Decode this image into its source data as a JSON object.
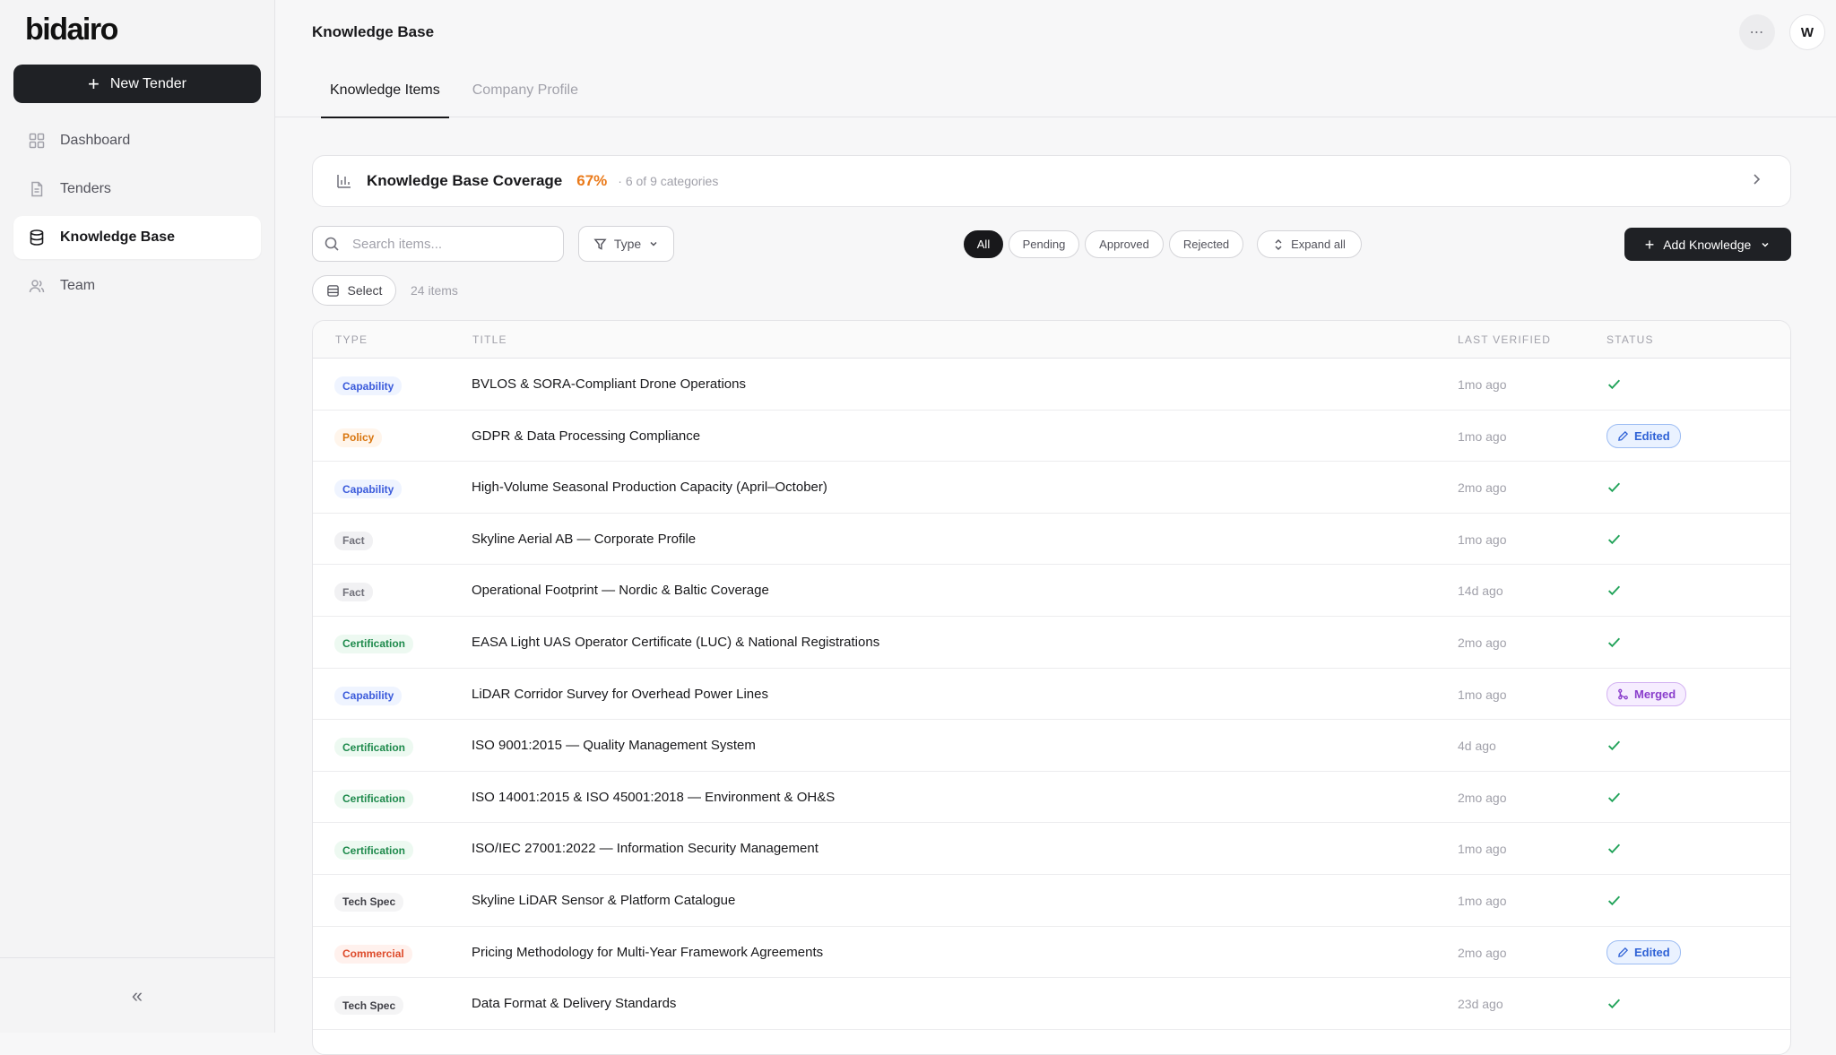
{
  "brand": {
    "logo_text": "bidairo"
  },
  "sidebar": {
    "new_tender_label": "New Tender",
    "items": [
      {
        "label": "Dashboard",
        "icon": "grid-icon",
        "active": false
      },
      {
        "label": "Tenders",
        "icon": "document-icon",
        "active": false
      },
      {
        "label": "Knowledge Base",
        "icon": "database-icon",
        "active": true
      },
      {
        "label": "Team",
        "icon": "users-icon",
        "active": false
      }
    ],
    "collapse_glyph": "«"
  },
  "header": {
    "title": "Knowledge Base",
    "avatar_initial": "W",
    "more_glyph": "⋯",
    "tabs": [
      {
        "label": "Knowledge Items",
        "active": true
      },
      {
        "label": "Company Profile",
        "active": false
      }
    ]
  },
  "coverage": {
    "title": "Knowledge Base Coverage",
    "percent": "67%",
    "subtitle": "· 6 of 9 categories",
    "accent_color": "#ea7a1a"
  },
  "toolbar": {
    "search_placeholder": "Search items...",
    "type_label": "Type",
    "filters": [
      {
        "label": "All",
        "active": true
      },
      {
        "label": "Pending",
        "active": false
      },
      {
        "label": "Approved",
        "active": false
      },
      {
        "label": "Rejected",
        "active": false
      }
    ],
    "expand_label": "Expand all",
    "add_label": "Add Knowledge"
  },
  "selection": {
    "select_label": "Select",
    "count_label": "24 items"
  },
  "table": {
    "columns": [
      "Type",
      "Title",
      "Last Verified",
      "Status"
    ],
    "rows": [
      {
        "type": "Capability",
        "type_key": "capability",
        "title": "BVLOS & SORA-Compliant Drone Operations",
        "verified": "1mo ago",
        "status": "approved"
      },
      {
        "type": "Policy",
        "type_key": "policy",
        "title": "GDPR & Data Processing Compliance",
        "verified": "1mo ago",
        "status": "edited",
        "status_label": "Edited"
      },
      {
        "type": "Capability",
        "type_key": "capability",
        "title": "High-Volume Seasonal Production Capacity (April–October)",
        "verified": "2mo ago",
        "status": "approved"
      },
      {
        "type": "Fact",
        "type_key": "fact",
        "title": "Skyline Aerial AB — Corporate Profile",
        "verified": "1mo ago",
        "status": "approved"
      },
      {
        "type": "Fact",
        "type_key": "fact",
        "title": "Operational Footprint — Nordic & Baltic Coverage",
        "verified": "14d ago",
        "status": "approved"
      },
      {
        "type": "Certification",
        "type_key": "certification",
        "title": "EASA Light UAS Operator Certificate (LUC) & National Registrations",
        "verified": "2mo ago",
        "status": "approved"
      },
      {
        "type": "Capability",
        "type_key": "capability",
        "title": "LiDAR Corridor Survey for Overhead Power Lines",
        "verified": "1mo ago",
        "status": "merged",
        "status_label": "Merged"
      },
      {
        "type": "Certification",
        "type_key": "certification",
        "title": "ISO 9001:2015 — Quality Management System",
        "verified": "4d ago",
        "status": "approved"
      },
      {
        "type": "Certification",
        "type_key": "certification",
        "title": "ISO 14001:2015 & ISO 45001:2018 — Environment & OH&S",
        "verified": "2mo ago",
        "status": "approved"
      },
      {
        "type": "Certification",
        "type_key": "certification",
        "title": "ISO/IEC 27001:2022 — Information Security Management",
        "verified": "1mo ago",
        "status": "approved"
      },
      {
        "type": "Tech Spec",
        "type_key": "techspec",
        "title": "Skyline LiDAR Sensor & Platform Catalogue",
        "verified": "1mo ago",
        "status": "approved"
      },
      {
        "type": "Commercial",
        "type_key": "commercial",
        "title": "Pricing Methodology for Multi-Year Framework Agreements",
        "verified": "2mo ago",
        "status": "edited",
        "status_label": "Edited"
      },
      {
        "type": "Tech Spec",
        "type_key": "techspec",
        "title": "Data Format & Delivery Standards",
        "verified": "23d ago",
        "status": "approved"
      }
    ]
  },
  "colors": {
    "primary_dark": "#1f2125",
    "check_green": "#22a35a",
    "edited_blue": "#2f62d6",
    "merged_purple": "#8a3ecc"
  }
}
